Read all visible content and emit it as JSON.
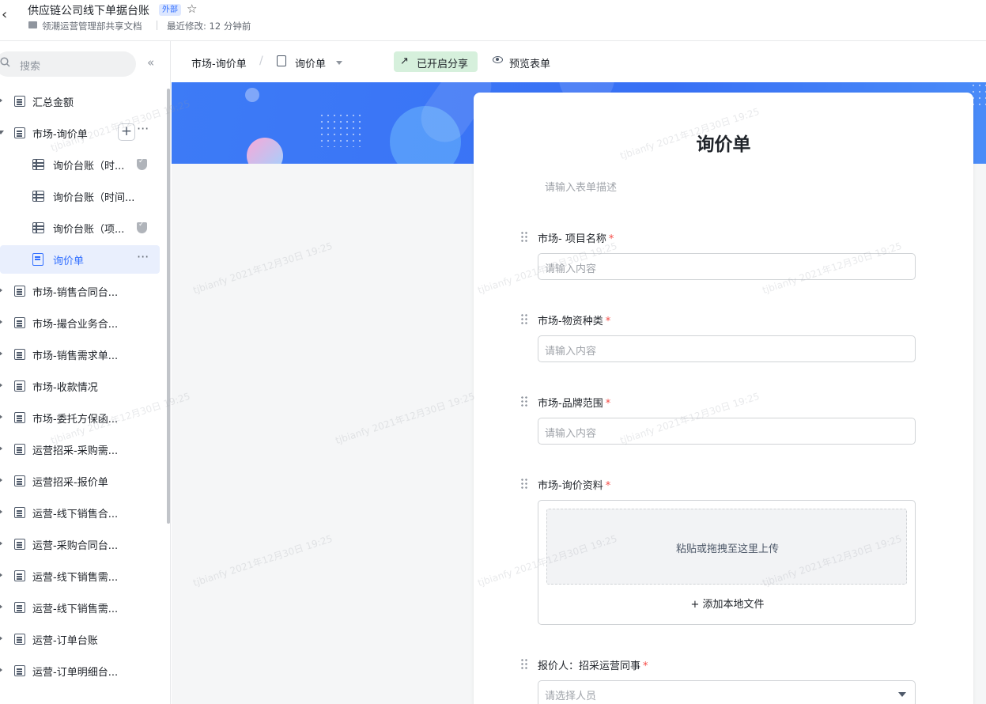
{
  "header": {
    "back_icon": "chevron-left-icon",
    "title": "供应链公司线下单据台账",
    "badge": "外部",
    "star_icon": "star-outline-icon",
    "folder": "领潮运营管理部共享文档",
    "last_modified": "最近修改: 12 分钟前"
  },
  "sidebar": {
    "search_placeholder": "搜索",
    "collapse_icon": "double-chevron-left-icon",
    "items": [
      {
        "label": "汇总金额",
        "icon": "doc-icon"
      },
      {
        "label": "市场-询价单",
        "icon": "doc-icon",
        "expanded": true
      },
      {
        "label": "询价台账（时...",
        "icon": "table-icon",
        "badge": "shield-icon"
      },
      {
        "label": "询价台账（时间...",
        "icon": "table-icon"
      },
      {
        "label": "询价台账（项...",
        "icon": "table-icon",
        "badge": "shield-icon"
      },
      {
        "label": "询价单",
        "icon": "form-icon",
        "active": true
      },
      {
        "label": "市场-销售合同台...",
        "icon": "doc-icon"
      },
      {
        "label": "市场-撮合业务合...",
        "icon": "doc-icon"
      },
      {
        "label": "市场-销售需求单...",
        "icon": "doc-icon"
      },
      {
        "label": "市场-收款情况",
        "icon": "doc-icon"
      },
      {
        "label": "市场-委托方保函...",
        "icon": "doc-icon"
      },
      {
        "label": "运营招采-采购需...",
        "icon": "doc-icon"
      },
      {
        "label": "运营招采-报价单",
        "icon": "doc-icon"
      },
      {
        "label": "运营-线下销售合...",
        "icon": "doc-icon"
      },
      {
        "label": "运营-采购合同台...",
        "icon": "doc-icon"
      },
      {
        "label": "运营-线下销售需...",
        "icon": "doc-icon"
      },
      {
        "label": "运营-线下销售需...",
        "icon": "doc-icon"
      },
      {
        "label": "运营-订单台账",
        "icon": "doc-icon"
      },
      {
        "label": "运营-订单明细台...",
        "icon": "doc-icon"
      }
    ]
  },
  "toolbar": {
    "crumb_parent": "市场-询价单",
    "crumb_sep": "/",
    "crumb_current": "询价单",
    "share_label": "已开启分享",
    "preview_label": "预览表单"
  },
  "form": {
    "title": "询价单",
    "description_placeholder": "请输入表单描述",
    "fields": [
      {
        "label": "市场- 项目名称",
        "required": true,
        "placeholder": "请输入内容"
      },
      {
        "label": "市场-物资种类",
        "required": true,
        "placeholder": "请输入内容"
      },
      {
        "label": "市场-品牌范围",
        "required": true,
        "placeholder": "请输入内容"
      },
      {
        "label": "市场-询价资料",
        "required": true,
        "upload_text": "粘贴或拖拽至这里上传",
        "add_file": "+ 添加本地文件"
      },
      {
        "label": "报价人：招采运营同事",
        "required": true,
        "placeholder": "请选择人员"
      }
    ]
  },
  "watermark": "tjbianfy 2021年12月30日 19:25",
  "colors": {
    "accent": "#3370ff",
    "banner": "#3870f5",
    "share_bg": "#d6f0dc",
    "required": "#f54a45"
  }
}
